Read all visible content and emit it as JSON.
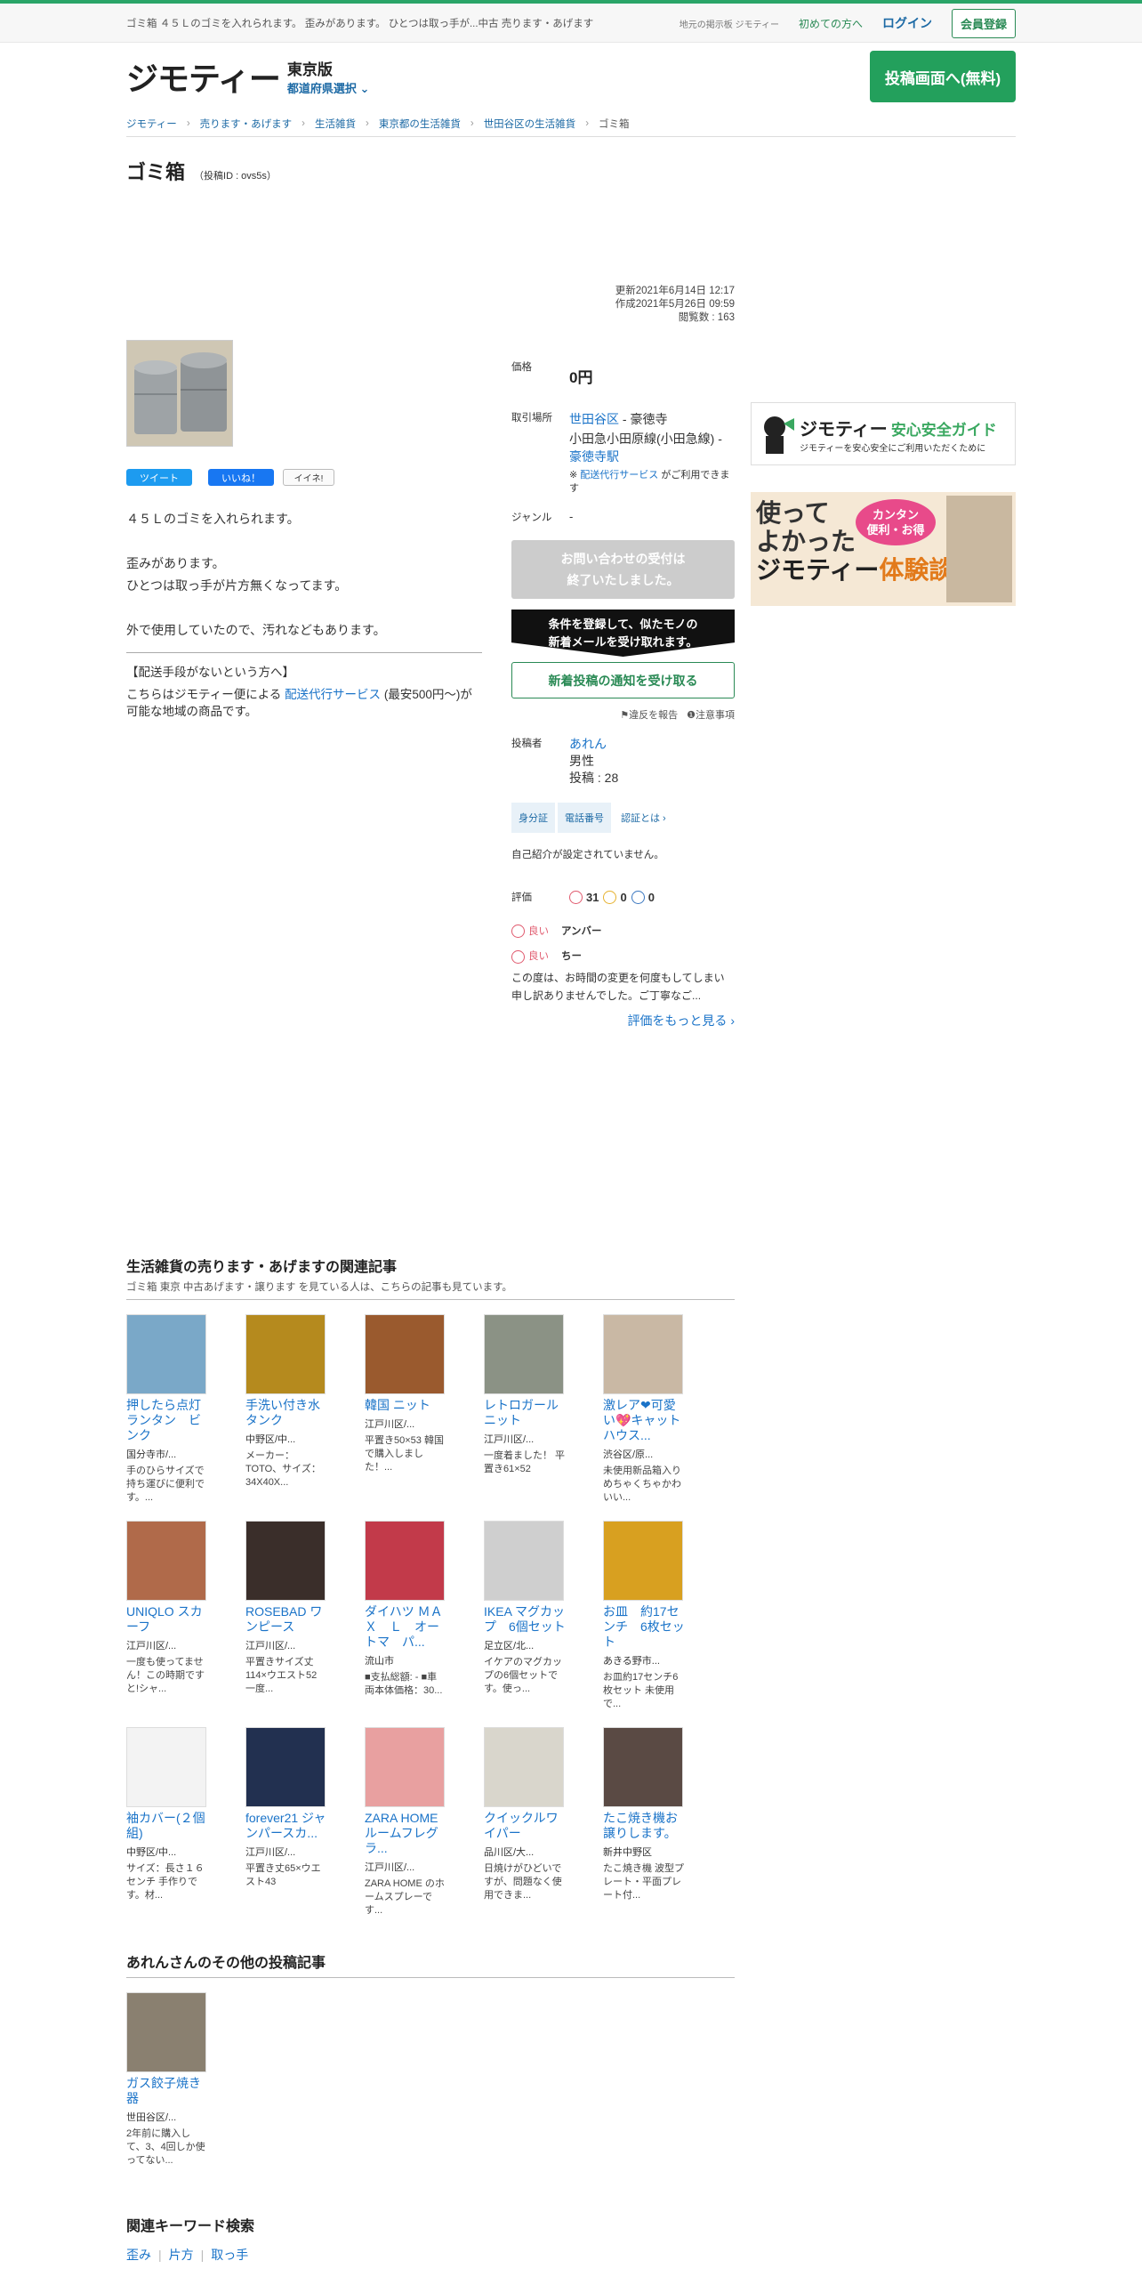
{
  "header": {
    "description": "ゴミ箱 ４５Ｌのゴミを入れられます。 歪みがあります。 ひとつは取っ手が...中古 売ります・あげます",
    "tagline": "地元の掲示板 ジモティー",
    "first_time": "初めての方へ",
    "login": "ログイン",
    "register": "会員登録"
  },
  "brand": {
    "logo": "ジモティー",
    "pref_name": "東京版",
    "pref_select": "都道府県選択 ⌄",
    "post_button": "投稿画面へ(無料)"
  },
  "breadcrumb": [
    "ジモティー",
    "売ります・あげます",
    "生活雑貨",
    "東京都の生活雑貨",
    "世田谷区の生活雑貨",
    "ゴミ箱"
  ],
  "post": {
    "title": "ゴミ箱",
    "id": "（投稿ID : ovs5s）",
    "updated": "更新2021年6月14日 12:17",
    "created": "作成2021年5月26日 09:59",
    "views": "閲覧数 : 163",
    "description": [
      "４５Ｌのゴミを入れられます。",
      "歪みがあります。",
      "ひとつは取っ手が片方無くなってます。",
      "外で使用していたので、汚れなどもあります。"
    ],
    "delivery_title": "【配送手段がないという方へ】",
    "delivery_pre": "こちらはジモティー便による",
    "delivery_link": "配送代行サービス",
    "delivery_post": "(最安500円〜)が可能な地域の商品です。"
  },
  "social": {
    "tweet": "ツイート",
    "like": "いいね！",
    "iine": "イイネ!"
  },
  "details": {
    "price_label": "価格",
    "price": "0円",
    "place_label": "取引場所",
    "ward": "世田谷区",
    "area": " - 豪徳寺",
    "line": "小田急小田原線(小田急線) - ",
    "station": "豪徳寺駅",
    "note_pre": "※ ",
    "note_link": "配送代行サービス",
    "note_post": " がご利用できます",
    "genre_label": "ジャンル",
    "genre": "-",
    "closed": "お問い合わせの受付は\n終了いたしました。",
    "promo": "条件を登録して、似たモノの\n新着メールを受け取れます。",
    "notify": "新着投稿の通知を受け取る",
    "report": "違反を報告",
    "caution": "注意事項"
  },
  "poster": {
    "label": "投稿者",
    "name": "あれん",
    "gender": "男性",
    "posts": "投稿 : 28",
    "badges": [
      "身分証",
      "電話番号",
      "認証とは ›"
    ],
    "intro": "自己紹介が設定されていません。",
    "eval_label": "評価",
    "good": "31",
    "normal": "0",
    "bad": "0",
    "reviews": [
      {
        "tag": "良い",
        "name": "アンバー"
      },
      {
        "tag": "良い",
        "name": "ちー"
      }
    ],
    "review_text": "この度は、お時間の変更を何度もしてしまい申し訳ありませんでした。ご丁寧なご...",
    "more": "評価をもっと見る ›"
  },
  "ads": {
    "guide_brand": "ジモティー",
    "guide_title": "安心安全ガイド",
    "guide_sub": "ジモティーを安心安全にご利用いただくために",
    "exp_line1": "使って",
    "exp_line2": "よかった",
    "exp_brand": "ジモティー",
    "exp_title": "体験談",
    "exp_bubble": "カンタン\n便利・お得"
  },
  "related": {
    "title": "生活雑貨の売ります・あげますの関連記事",
    "sub": "ゴミ箱 東京 中古あげます・譲ります を見ている人は、こちらの記事も見ています。",
    "items": [
      {
        "name": "押したら点灯 ランタン　ビンク",
        "loc": "国分寺市/...",
        "desc": "手のひらサイズで持ち運びに便利です。...",
        "color": "#7aa8c8"
      },
      {
        "name": "手洗い付き水タンク",
        "loc": "中野区/中...",
        "desc": "メーカー：TOTO、サイズ：34X40X...",
        "color": "#b58a1e"
      },
      {
        "name": "韓国 ニット",
        "loc": "江戸川区/...",
        "desc": "平置き50×53 韓国で購入しました！...",
        "color": "#9a5a2e"
      },
      {
        "name": "レトロガールニット",
        "loc": "江戸川区/...",
        "desc": "一度着ました！ 平置き61×52",
        "color": "#8b9285"
      },
      {
        "name": "激レア❤︎可愛い💖キャットハウス...",
        "loc": "渋谷区/原...",
        "desc": "未使用新品箱入り めちゃくちゃかわいい...",
        "color": "#c9b8a4"
      },
      {
        "name": "UNIQLO スカーフ",
        "loc": "江戸川区/...",
        "desc": "一度も使ってません！この時期ですと!シャ...",
        "color": "#b06a4a"
      },
      {
        "name": "ROSEBAD ワンピース",
        "loc": "江戸川区/...",
        "desc": "平置きサイズ丈114×ウエスト52 一度...",
        "color": "#3a2e2a"
      },
      {
        "name": "ダイハツ ＭＡＸ　Ｌ　オートマ　パ...",
        "loc": "流山市",
        "desc": "■支払総額: - ■車両本体価格：30...",
        "color": "#c23a4a"
      },
      {
        "name": "IKEA マグカップ　6個セット",
        "loc": "足立区/北...",
        "desc": "イケアのマグカップの6個セットです。使っ...",
        "color": "#cfcfcf"
      },
      {
        "name": "お皿　約17センチ　6枚セット",
        "loc": "あきる野市...",
        "desc": "お皿約17センチ6枚セット 未使用で...",
        "color": "#d8a020"
      },
      {
        "name": "袖カバー(２個組)",
        "loc": "中野区/中...",
        "desc": "サイズ：長さ１６センチ 手作りです。材...",
        "color": "#f3f3f3"
      },
      {
        "name": "forever21 ジャンパースカ...",
        "loc": "江戸川区/...",
        "desc": "平置き丈65×ウエスト43",
        "color": "#223050"
      },
      {
        "name": "ZARA HOME ルームフレグラ...",
        "loc": "江戸川区/...",
        "desc": "ZARA HOME のホームスプレーです...",
        "color": "#e8a0a0"
      },
      {
        "name": "クイックルワイパー",
        "loc": "品川区/大...",
        "desc": "日焼けがひどいですが、問題なく使用できま...",
        "color": "#d9d6cc"
      },
      {
        "name": "たこ焼き機お譲りします。",
        "loc": "新井中野区",
        "desc": "たこ焼き機 波型プレート・平面プレート付...",
        "color": "#5a4a44"
      }
    ]
  },
  "other": {
    "title": "あれんさんのその他の投稿記事",
    "items": [
      {
        "name": "ガス餃子焼き器",
        "loc": "世田谷区/...",
        "desc": "2年前に購入して、3、4回しか使ってない...",
        "color": "#8a8070"
      }
    ]
  },
  "keywords": {
    "title": "関連キーワード検索",
    "links": [
      "歪み",
      "片方",
      "取っ手"
    ]
  },
  "colors": {
    "brand_green": "#23a05c",
    "link_blue": "#1a73c8"
  }
}
